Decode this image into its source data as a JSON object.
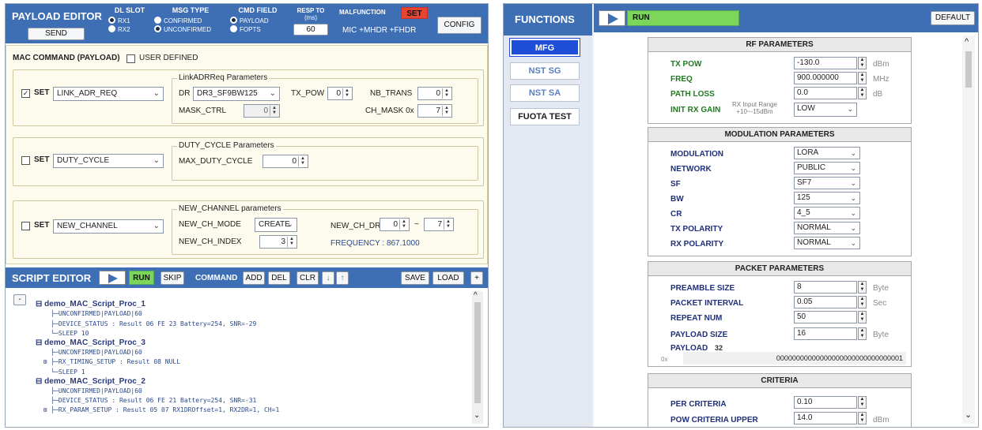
{
  "payload_editor": {
    "title": "PAYLOAD EDITOR",
    "send": "SEND",
    "dl_slot": {
      "label": "DL SLOT",
      "options": [
        "RX1",
        "RX2"
      ],
      "selected": "RX1"
    },
    "msg_type": {
      "label": "MSG TYPE",
      "options": [
        "CONFIRMED",
        "UNCONFIRMED"
      ],
      "selected": "UNCONFIRMED"
    },
    "cmd_field": {
      "label": "CMD FIELD",
      "options": [
        "PAYLOAD",
        "FOPTS"
      ],
      "selected": "PAYLOAD"
    },
    "resp_to": {
      "label": "RESP TO",
      "unit": "(ms)",
      "value": "60"
    },
    "malfunction": {
      "label": "MALFUNCTION",
      "set": "SET",
      "value": "MIC +MHDR +FHDR"
    },
    "config": "CONFIG",
    "mac_command_label": "MAC COMMAND (PAYLOAD)",
    "user_defined": "USER DEFINED",
    "link_adr": {
      "set": "SET",
      "checked": true,
      "command": "LINK_ADR_REQ",
      "group": "LinkADRReq Parameters",
      "dr_label": "DR",
      "dr_value": "DR3_SF9BW125",
      "tx_pow_label": "TX_POW",
      "tx_pow": "0",
      "nb_trans_label": "NB_TRANS",
      "nb_trans": "0",
      "mask_ctrl_label": "MASK_CTRL",
      "mask_ctrl": "0",
      "ch_mask_label": "CH_MASK 0x",
      "ch_mask": "7"
    },
    "duty": {
      "set": "SET",
      "checked": false,
      "command": "DUTY_CYCLE",
      "group": "DUTY_CYCLE Parameters",
      "max_label": "MAX_DUTY_CYCLE",
      "max_value": "0"
    },
    "newch": {
      "set": "SET",
      "checked": false,
      "command": "NEW_CHANNEL",
      "group": "NEW_CHANNEL parameters",
      "mode_label": "NEW_CH_MODE",
      "mode_value": "CREATE",
      "index_label": "NEW_CH_INDEX",
      "index_value": "3",
      "dr_label": "NEW_CH_DR",
      "dr_min": "0",
      "tilde": "~",
      "dr_max": "7",
      "frequency": "FREQUENCY : 867.1000"
    }
  },
  "script_editor": {
    "title": "SCRIPT EDITOR",
    "run": "RUN",
    "skip": "SKIP",
    "command": "COMMAND",
    "add": "ADD",
    "del": "DEL",
    "clr": "CLR",
    "save": "SAVE",
    "load": "LOAD",
    "plus": "+",
    "collapse": "-",
    "tree": [
      {
        "name": "demo_MAC_Script_Proc_1",
        "lines": [
          "UNCONFIRMED|PAYLOAD|60",
          "DEVICE_STATUS : Result 06 FE 23 Battery=254, SNR=-29",
          "SLEEP 10"
        ]
      },
      {
        "name": "demo_MAC_Script_Proc_3",
        "lines": [
          "UNCONFIRMED|PAYLOAD|60",
          "RX_TIMING_SETUP : Result 08 NULL",
          "SLEEP 1"
        ]
      },
      {
        "name": "demo_MAC_Script_Proc_2",
        "lines": [
          "UNCONFIRMED|PAYLOAD|60",
          "DEVICE_STATUS : Result 06 FE 21 Battery=254, SNR=-31",
          "RX_PARAM_SETUP : Result 05 07 RX1DROffset=1, RX2DR=1, CH=1"
        ]
      }
    ]
  },
  "functions": {
    "title": "FUNCTIONS",
    "items": [
      "MFG",
      "NST SG",
      "NST SA",
      "FUOTA TEST"
    ],
    "active": "MFG"
  },
  "mfg": {
    "run": "RUN",
    "default": "DEFAULT",
    "rf": {
      "title": "RF PARAMETERS",
      "tx_pow": {
        "label": "TX POW",
        "value": "-130.0",
        "unit": "dBm"
      },
      "freq": {
        "label": "FREQ",
        "value": "900.000000",
        "unit": "MHz"
      },
      "path_loss": {
        "label": "PATH LOSS",
        "value": "0.0",
        "unit": "dB"
      },
      "init_rx_gain": {
        "label": "INIT RX GAIN",
        "note1": "RX Input Range",
        "note2": "+10~-15dBm",
        "value": "LOW"
      }
    },
    "mod": {
      "title": "MODULATION PARAMETERS",
      "rows": [
        {
          "label": "MODULATION",
          "value": "LORA"
        },
        {
          "label": "NETWORK",
          "value": "PUBLIC"
        },
        {
          "label": "SF",
          "value": "SF7"
        },
        {
          "label": "BW",
          "value": "125"
        },
        {
          "label": "CR",
          "value": "4_5"
        },
        {
          "label": "TX POLARITY",
          "value": "NORMAL"
        },
        {
          "label": "RX POLARITY",
          "value": "NORMAL"
        }
      ]
    },
    "packet": {
      "title": "PACKET PARAMETERS",
      "preamble": {
        "label": "PREAMBLE SIZE",
        "value": "8",
        "unit": "Byte"
      },
      "interval": {
        "label": "PACKET INTERVAL",
        "value": "0.05",
        "unit": "Sec"
      },
      "repeat": {
        "label": "REPEAT NUM",
        "value": "50"
      },
      "payload_size": {
        "label": "PAYLOAD SIZE",
        "value": "16",
        "unit": "Byte"
      },
      "payload_label": "PAYLOAD",
      "payload_len": "32",
      "prefix": "0x",
      "payload": "00000000000000000000000000000001"
    },
    "criteria": {
      "title": "CRITERIA",
      "per": {
        "label": "PER CRITERIA",
        "value": "0.10"
      },
      "pow_upper": {
        "label": "POW CRITERIA UPPER",
        "value": "14.0",
        "unit": "dBm"
      }
    }
  },
  "colors": {
    "header_blue": "#3e6fb5",
    "panel_cream": "#fdfaee",
    "malfunction_red": "#e8442f",
    "run_green": "#7cd65a",
    "active_blue": "#1e4ed8"
  }
}
